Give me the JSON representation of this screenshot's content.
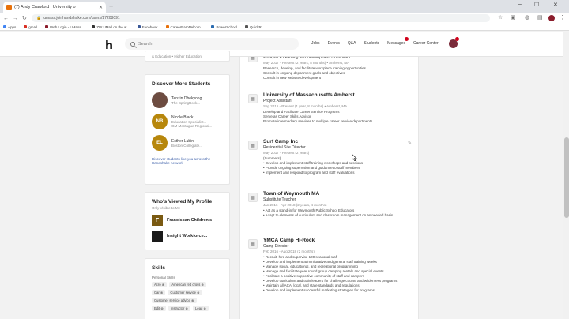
{
  "browser": {
    "tab_title": "(7) Andy Crawford | University o",
    "url": "umass.joinhandshake.com/users/27208091",
    "bookmarks": [
      {
        "label": "Apps",
        "color": "#4285f4"
      },
      {
        "label": "gmail",
        "color": "#d93025"
      },
      {
        "label": "Web Login - UMass...",
        "color": "#8b1d2c"
      },
      {
        "label": "ZW UMail on the w...",
        "color": "#333333"
      },
      {
        "label": "Facebook",
        "color": "#3b5998"
      },
      {
        "label": "CareerBar Welcom...",
        "color": "#e8710a"
      },
      {
        "label": "PowerSchool",
        "color": "#2b6cb0"
      },
      {
        "label": "QuickR",
        "color": "#555555"
      }
    ]
  },
  "header": {
    "logo": "h",
    "search_placeholder": "Search",
    "nav": [
      "Jobs",
      "Events",
      "Q&A",
      "Students",
      "Messages",
      "Career Center"
    ]
  },
  "sidebar": {
    "top_cut_text": "& Education • Higher Education",
    "discover": {
      "title": "Discover More Students",
      "students": [
        {
          "initials": "",
          "name": "Tenzin Dhekyong",
          "sub": "The SpringRock...",
          "color": "#6d4c41"
        },
        {
          "initials": "NB",
          "name": "Nicole Black",
          "sub": "Education Specialist...",
          "sub2": "GM Montague Regional...",
          "color": "#b7870c"
        },
        {
          "initials": "EL",
          "name": "Esther Lubin",
          "sub": "Boston Collegiate...",
          "color": "#b7870c"
        }
      ],
      "footer": "Discover students like you across the Handshake network"
    },
    "viewed": {
      "title": "Who's Viewed My Profile",
      "subtitle": "Only Visible to Me",
      "orgs": [
        {
          "logo": "F",
          "name": "Franciscan Children's",
          "color": "#7a5a12"
        },
        {
          "logo": "",
          "name": "Insight Workforce...",
          "color": "#1a1a1a"
        }
      ]
    },
    "skills": {
      "title": "Skills",
      "subtitle": "Personal Skills",
      "rows": [
        [
          "Acro ⊗",
          "American red cross ⊗"
        ],
        [
          "Car ⊗",
          "Customer service ⊗"
        ],
        [
          "Customer service advice ⊗"
        ],
        [
          "Edit ⊗",
          "Instructor ⊗",
          "Lead ⊗"
        ]
      ]
    }
  },
  "experience": [
    {
      "org": "",
      "role": "Workplace Learning and Development Consultant",
      "dates": "May 2017 - Present (2 years, 8 months) • Amherst, MA",
      "lines": [
        "Research, develop, and facilitate workplace training opportunities",
        "Consult in ongoing department goals and objectives",
        "Consult in new website development"
      ]
    },
    {
      "org": "University of Massachusetts Amherst",
      "role": "Project Assistant",
      "dates": "Sep 2016 - Present (1 year, 8 months) • Amherst, MA",
      "lines": [
        "Develop and Facilitate Career Service Programs",
        "Serve as Career Skills Advisor",
        "Promote intermediary services to multiple career service departments"
      ]
    },
    {
      "org": "Surf Camp Inc",
      "role": "Residential Site Director",
      "dates": "May 2017 - Present (2 years)",
      "lines": [
        "(Summers)",
        "• Develop and implement staff training workshops and sessions",
        "• Provide ongoing supervision and guidance to staff members",
        "• Implement and respond to program and staff evaluations"
      ]
    },
    {
      "org": "Town of Weymouth MA",
      "role": "Substitute Teacher",
      "dates": "Jan 2016 - Apr 2018 (2 years, 4 months)",
      "lines": [
        "• Act as a stand-in for Weymouth Public School Educators",
        "• Adapt to elements of curriculum and classroom management on as needed basis"
      ]
    },
    {
      "org": "YMCA Camp Hi-Rock",
      "role": "Camp Director",
      "dates": "Feb 2016 - Aug 2018 (2 months)",
      "lines": [
        "• Recruit, hire and supervise 100 seasonal staff",
        "• Develop and implement administrative and general staff training weeks",
        "• Manage social, educational, and recreational programming",
        "• Manage and facilitate year round group camping rentals and special events",
        "• Facilitate a positive supportive community of staff and campers",
        "• Develop curriculum and train leaders for challenge course and wilderness programs",
        "• Maintain all ACA, local, and state standards and regulations",
        "• Develop and implement successful marketing strategies for programs"
      ]
    }
  ]
}
